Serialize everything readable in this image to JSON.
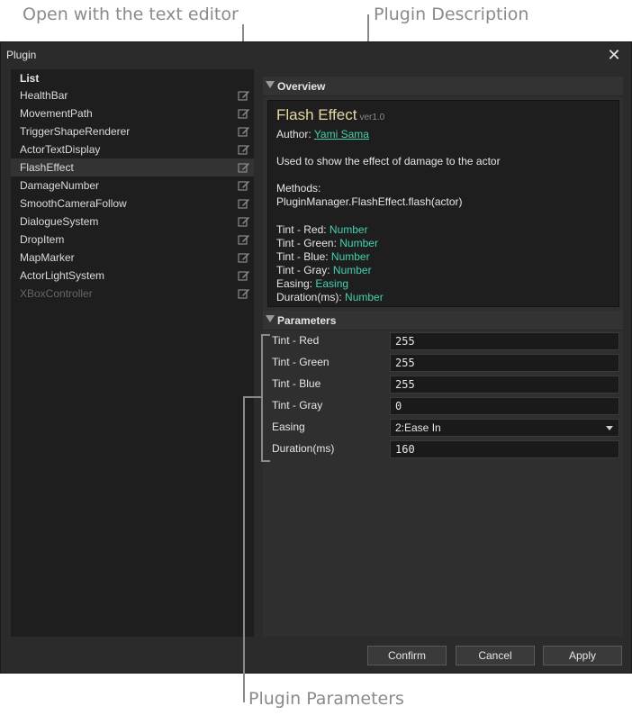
{
  "annotations": {
    "text_editor": "Open with the text editor",
    "description": "Plugin Description",
    "parameters": "Plugin Parameters"
  },
  "window": {
    "title": "Plugin",
    "close": "✕"
  },
  "list": {
    "header": "List",
    "items": [
      {
        "label": "HealthBar"
      },
      {
        "label": "MovementPath"
      },
      {
        "label": "TriggerShapeRenderer"
      },
      {
        "label": "ActorTextDisplay"
      },
      {
        "label": "FlashEffect",
        "selected": true
      },
      {
        "label": "DamageNumber"
      },
      {
        "label": "SmoothCameraFollow"
      },
      {
        "label": "DialogueSystem"
      },
      {
        "label": "DropItem"
      },
      {
        "label": "MapMarker"
      },
      {
        "label": "ActorLightSystem"
      },
      {
        "label": "XBoxController",
        "disabled": true
      }
    ],
    "edit_icon": "pencil-square-icon"
  },
  "overview": {
    "header": "Overview",
    "plugin_name": "Flash Effect",
    "version": "ver1.0",
    "author_label": "Author: ",
    "author_name": "Yami Sama",
    "description": "Used to show the effect of damage to the actor",
    "methods_label": "Methods:",
    "methods_value": "PluginManager.FlashEffect.flash(actor)",
    "param_types": [
      {
        "name": "Tint - Red:",
        "type": "Number"
      },
      {
        "name": "Tint - Green:",
        "type": "Number"
      },
      {
        "name": "Tint - Blue:",
        "type": "Number"
      },
      {
        "name": "Tint - Gray:",
        "type": "Number"
      },
      {
        "name": "Easing:",
        "type": "Easing"
      },
      {
        "name": "Duration(ms):",
        "type": "Number"
      }
    ]
  },
  "parameters": {
    "header": "Parameters",
    "rows": [
      {
        "label": "Tint - Red",
        "value": "255"
      },
      {
        "label": "Tint - Green",
        "value": "255"
      },
      {
        "label": "Tint - Blue",
        "value": "255"
      },
      {
        "label": "Tint - Gray",
        "value": "0"
      },
      {
        "label": "Easing",
        "value": "2:Ease In",
        "kind": "select"
      },
      {
        "label": "Duration(ms)",
        "value": "160"
      }
    ]
  },
  "buttons": {
    "confirm": "Confirm",
    "cancel": "Cancel",
    "apply": "Apply"
  },
  "colors": {
    "accent": "#45d1b0",
    "title": "#e8d7a4",
    "window_bg": "#2b2b2b",
    "panel_bg": "#1e1e1e"
  }
}
